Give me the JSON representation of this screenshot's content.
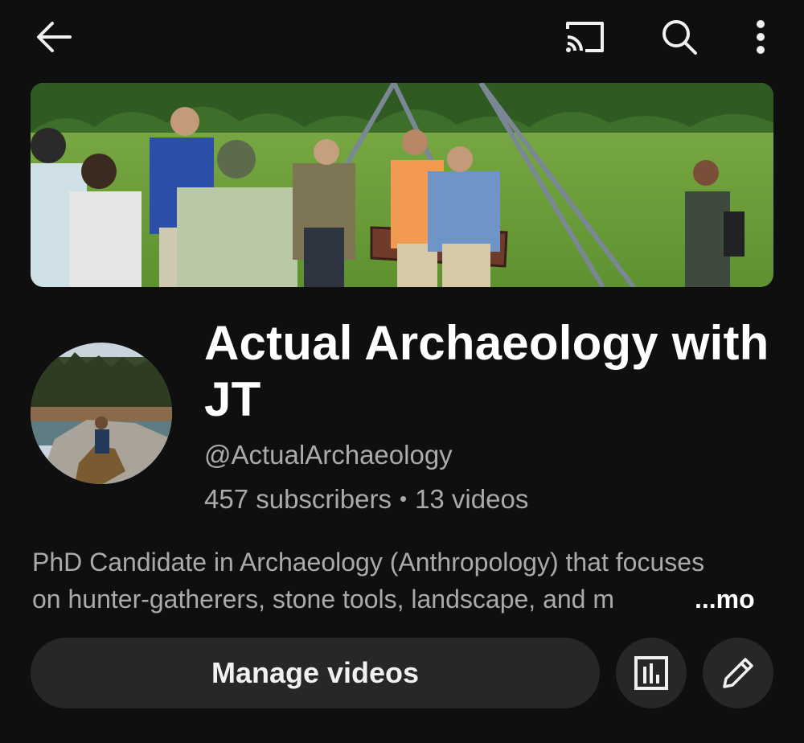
{
  "icons": {
    "back": "arrow-left-icon",
    "cast": "cast-icon",
    "search": "search-icon",
    "more": "more-vertical-icon",
    "analytics": "analytics-icon",
    "edit": "pencil-icon"
  },
  "channel": {
    "title": "Actual Archaeology with JT",
    "handle": "@ActualArchaeology",
    "subscribers": "457 subscribers",
    "separator": "•",
    "videos": "13 videos"
  },
  "description": {
    "line1": "PhD Candidate in Archaeology (Anthropology) that focuses",
    "line2": "on hunter-gatherers, stone tools, landscape, and m",
    "more_label": "...more"
  },
  "actions": {
    "manage_label": "Manage videos"
  },
  "colors": {
    "background": "#0f0f0f",
    "button_bg": "#272727",
    "secondary_text": "#aaaaaa",
    "primary_text": "#ffffff"
  }
}
